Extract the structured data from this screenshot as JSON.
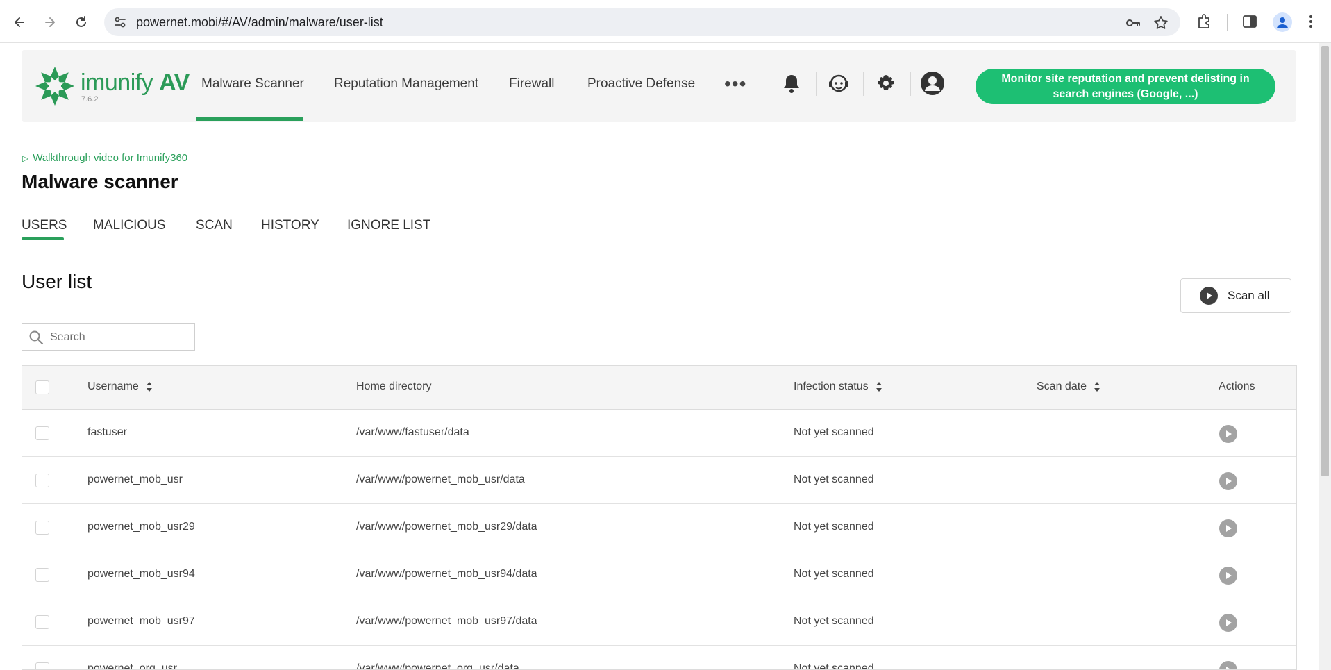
{
  "browser": {
    "url": "powernet.mobi/#/AV/admin/malware/user-list"
  },
  "app": {
    "logo_name": "imunify",
    "logo_suffix": "AV",
    "version": "7.6.2",
    "nav": [
      {
        "label": "Malware Scanner",
        "active": true
      },
      {
        "label": "Reputation Management",
        "active": false
      },
      {
        "label": "Firewall",
        "active": false
      },
      {
        "label": "Proactive Defense",
        "active": false
      }
    ],
    "more_label": "•••",
    "promo_label": "Monitor site reputation and prevent delisting in search engines (Google, ...)",
    "accent_color": "#2aa05b",
    "promo_color": "#1dbf73"
  },
  "page": {
    "walkthrough_link": "Walkthrough video for Imunify360",
    "title": "Malware scanner",
    "tabs": [
      {
        "label": "USERS",
        "active": true
      },
      {
        "label": "MALICIOUS",
        "active": false
      },
      {
        "label": "SCAN",
        "active": false
      },
      {
        "label": "HISTORY",
        "active": false
      },
      {
        "label": "IGNORE LIST",
        "active": false
      }
    ],
    "section_title": "User list",
    "scan_all_label": "Scan all",
    "search_placeholder": "Search"
  },
  "table": {
    "columns": {
      "username": "Username",
      "home": "Home directory",
      "status": "Infection status",
      "date": "Scan date",
      "actions": "Actions"
    },
    "rows": [
      {
        "username": "fastuser",
        "home": "/var/www/fastuser/data",
        "status": "Not yet scanned",
        "date": ""
      },
      {
        "username": "powernet_mob_usr",
        "home": "/var/www/powernet_mob_usr/data",
        "status": "Not yet scanned",
        "date": ""
      },
      {
        "username": "powernet_mob_usr29",
        "home": "/var/www/powernet_mob_usr29/data",
        "status": "Not yet scanned",
        "date": ""
      },
      {
        "username": "powernet_mob_usr94",
        "home": "/var/www/powernet_mob_usr94/data",
        "status": "Not yet scanned",
        "date": ""
      },
      {
        "username": "powernet_mob_usr97",
        "home": "/var/www/powernet_mob_usr97/data",
        "status": "Not yet scanned",
        "date": ""
      },
      {
        "username": "powernet_org_usr",
        "home": "/var/www/powernet_org_usr/data",
        "status": "Not yet scanned",
        "date": ""
      }
    ]
  }
}
